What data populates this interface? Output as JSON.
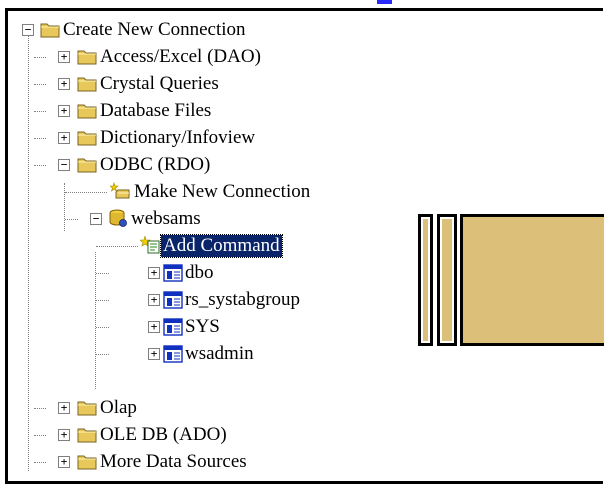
{
  "tree": {
    "root": {
      "label": "Create New Connection",
      "expanded": true,
      "children": [
        {
          "label": "Access/Excel (DAO)",
          "expanded": false
        },
        {
          "label": "Crystal Queries",
          "expanded": false
        },
        {
          "label": "Database Files",
          "expanded": false
        },
        {
          "label": "Dictionary/Infoview",
          "expanded": false
        },
        {
          "label": "ODBC (RDO)",
          "expanded": true,
          "children": [
            {
              "label": "Make New Connection"
            },
            {
              "label": "websams",
              "expanded": true,
              "children": [
                {
                  "label": "Add Command",
                  "selected": true
                },
                {
                  "label": "dbo",
                  "expanded": false
                },
                {
                  "label": "rs_systabgroup",
                  "expanded": false
                },
                {
                  "label": "SYS",
                  "expanded": false
                },
                {
                  "label": "wsadmin",
                  "expanded": false
                }
              ]
            }
          ]
        },
        {
          "label": "Olap",
          "expanded": false
        },
        {
          "label": "OLE DB (ADO)",
          "expanded": false
        },
        {
          "label": "More Data Sources",
          "expanded": false
        }
      ]
    }
  },
  "colors": {
    "selection_bg": "#0a246a",
    "selection_fg": "#ffffff",
    "folder": "#e8c85a",
    "overlay_fill": "#dcbf78",
    "link_blue": "#2a2aff"
  },
  "icons": {
    "folder": "folder-icon",
    "make_connection": "new-connection-wand-icon",
    "database": "database-icon",
    "add_command": "add-command-icon",
    "schema": "schema-table-icon"
  }
}
